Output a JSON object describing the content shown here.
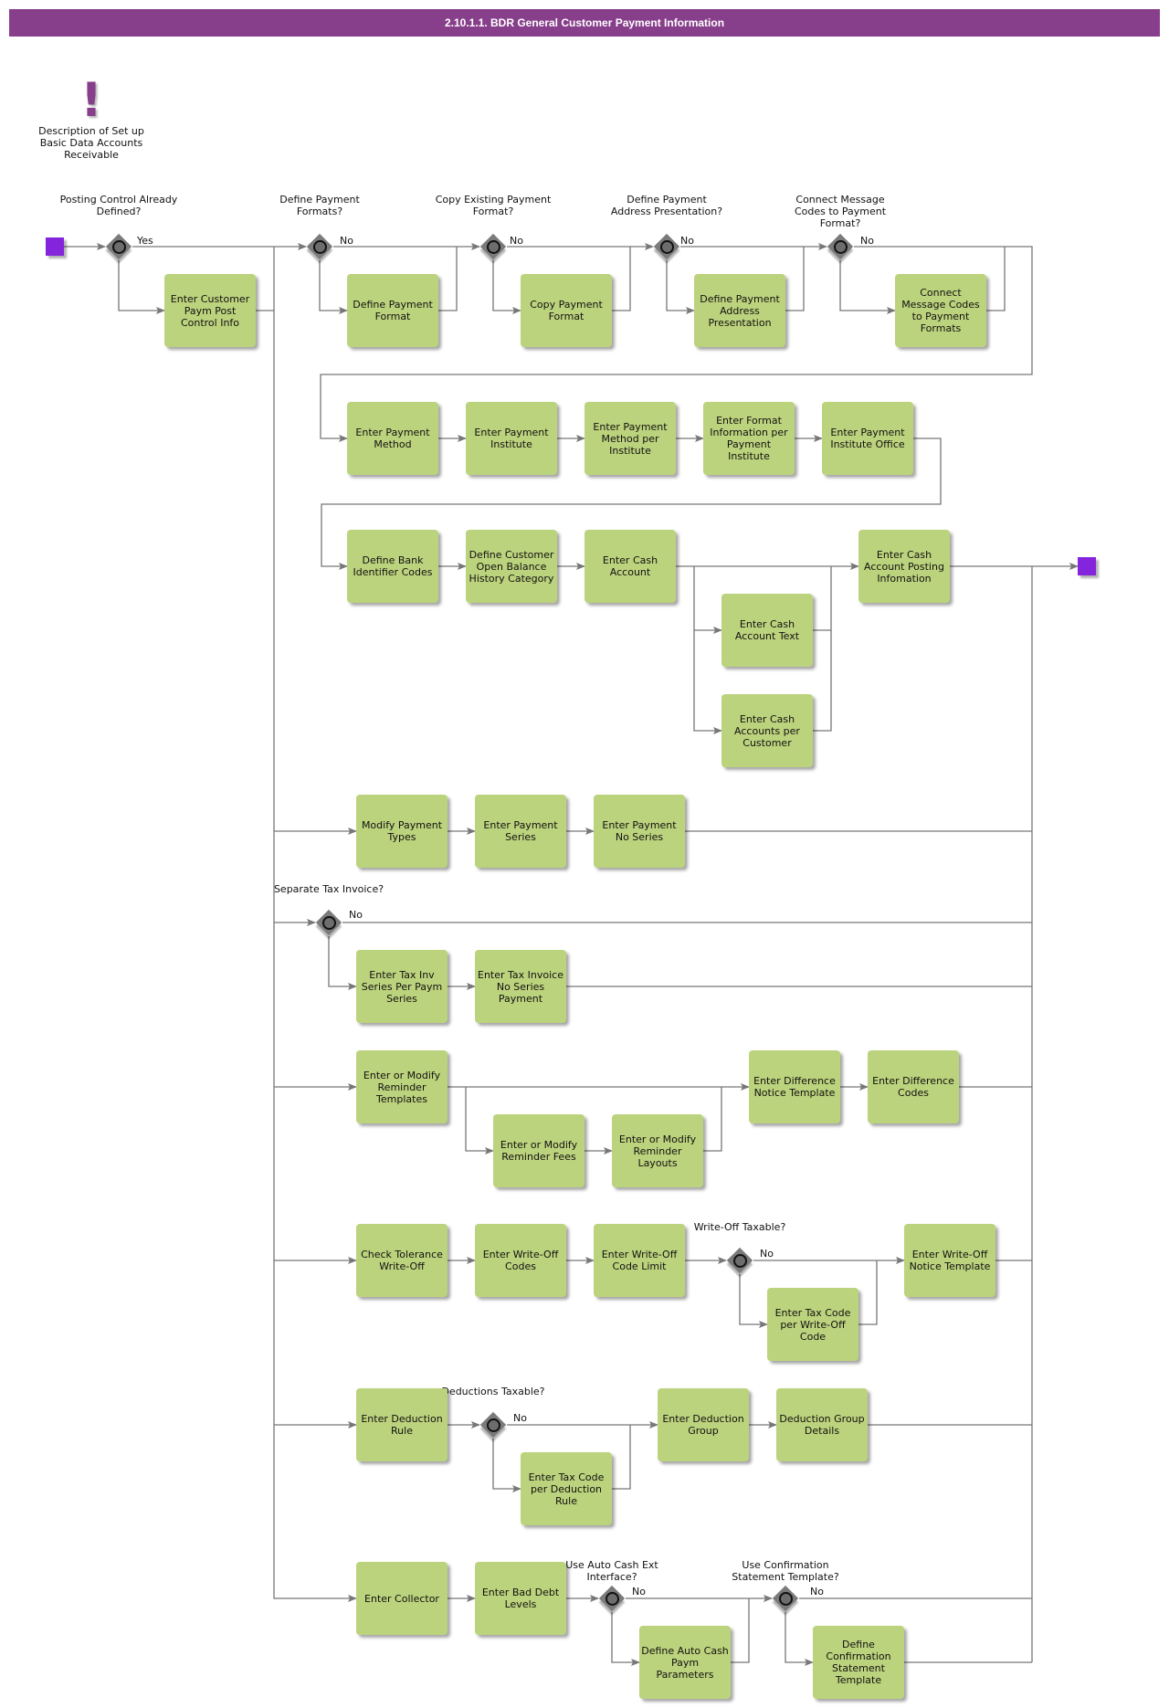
{
  "title": "2.10.1.1. BDR General Customer Payment Information",
  "colors": {
    "title_bar": "#873f8b",
    "task": "#bcd37d",
    "event": "#8424dc",
    "gateway": "#7a7a7a",
    "connector": "#777777"
  },
  "note": {
    "icon": "exclamation-icon",
    "text": "Description of Set up Basic Data Accounts Receivable"
  },
  "gateways": {
    "g1": {
      "label": "Posting Control Already Defined?",
      "flow": "Yes"
    },
    "g2": {
      "label": "Define Payment Formats?",
      "flow": "No"
    },
    "g3": {
      "label": "Copy Existing Payment Format?",
      "flow": "No"
    },
    "g4": {
      "label": "Define Payment Address Presentation?",
      "flow": "No"
    },
    "g5": {
      "label": "Connect Message Codes to Payment Format?",
      "flow": "No"
    },
    "g6": {
      "label": "Separate Tax Invoice?",
      "flow": "No"
    },
    "g7": {
      "label": "Write-Off Taxable?",
      "flow": "No"
    },
    "g8": {
      "label": "Deductions Taxable?",
      "flow": "No"
    },
    "g9": {
      "label": "Use Auto Cash Ext Interface?",
      "flow": "No"
    },
    "g10": {
      "label": "Use Confirmation Statement Template?",
      "flow": "No"
    }
  },
  "tasks": {
    "t1": "Enter Customer Paym Post Control Info",
    "t2": "Define Payment Format",
    "t3": "Copy Payment Format",
    "t4": "Define Payment Address Presentation",
    "t5": "Connect Message Codes to Payment Formats",
    "t6": "Enter Payment Method",
    "t7": "Enter Payment Institute",
    "t8": "Enter Payment Method per Institute",
    "t9": "Enter Format Information per Payment Institute",
    "t10": "Enter Payment Institute Office",
    "t11": "Define Bank Identifier Codes",
    "t12": "Define Customer Open Balance History Category",
    "t13": "Enter Cash Account",
    "t14": "Enter Cash Account Text",
    "t15": "Enter Cash Accounts per Customer",
    "t16": "Enter Cash Account Posting Infomation",
    "t17": "Modify Payment Types",
    "t18": "Enter Payment Series",
    "t19": "Enter Payment No Series",
    "t20": "Enter Tax Inv Series Per Paym Series",
    "t21": "Enter Tax Invoice No Series Payment",
    "t22": "Enter or Modify Reminder Templates",
    "t23": "Enter or Modify Reminder Fees",
    "t24": "Enter or Modify Reminder Layouts",
    "t25": "Enter Difference Notice Template",
    "t26": "Enter Difference Codes",
    "t27": "Check Tolerance Write-Off",
    "t28": "Enter Write-Off Codes",
    "t29": "Enter Write-Off Code Limit",
    "t30": "Enter Tax Code per Write-Off Code",
    "t31": "Enter Write-Off Notice Template",
    "t32": "Enter Deduction Rule",
    "t33": "Enter Tax Code per Deduction Rule",
    "t34": "Enter Deduction Group",
    "t35": "Deduction Group Details",
    "t36": "Enter Collector",
    "t37": "Enter Bad Debt Levels",
    "t38": "Define Auto Cash Paym Parameters",
    "t39": "Define Confirmation Statement Template"
  }
}
